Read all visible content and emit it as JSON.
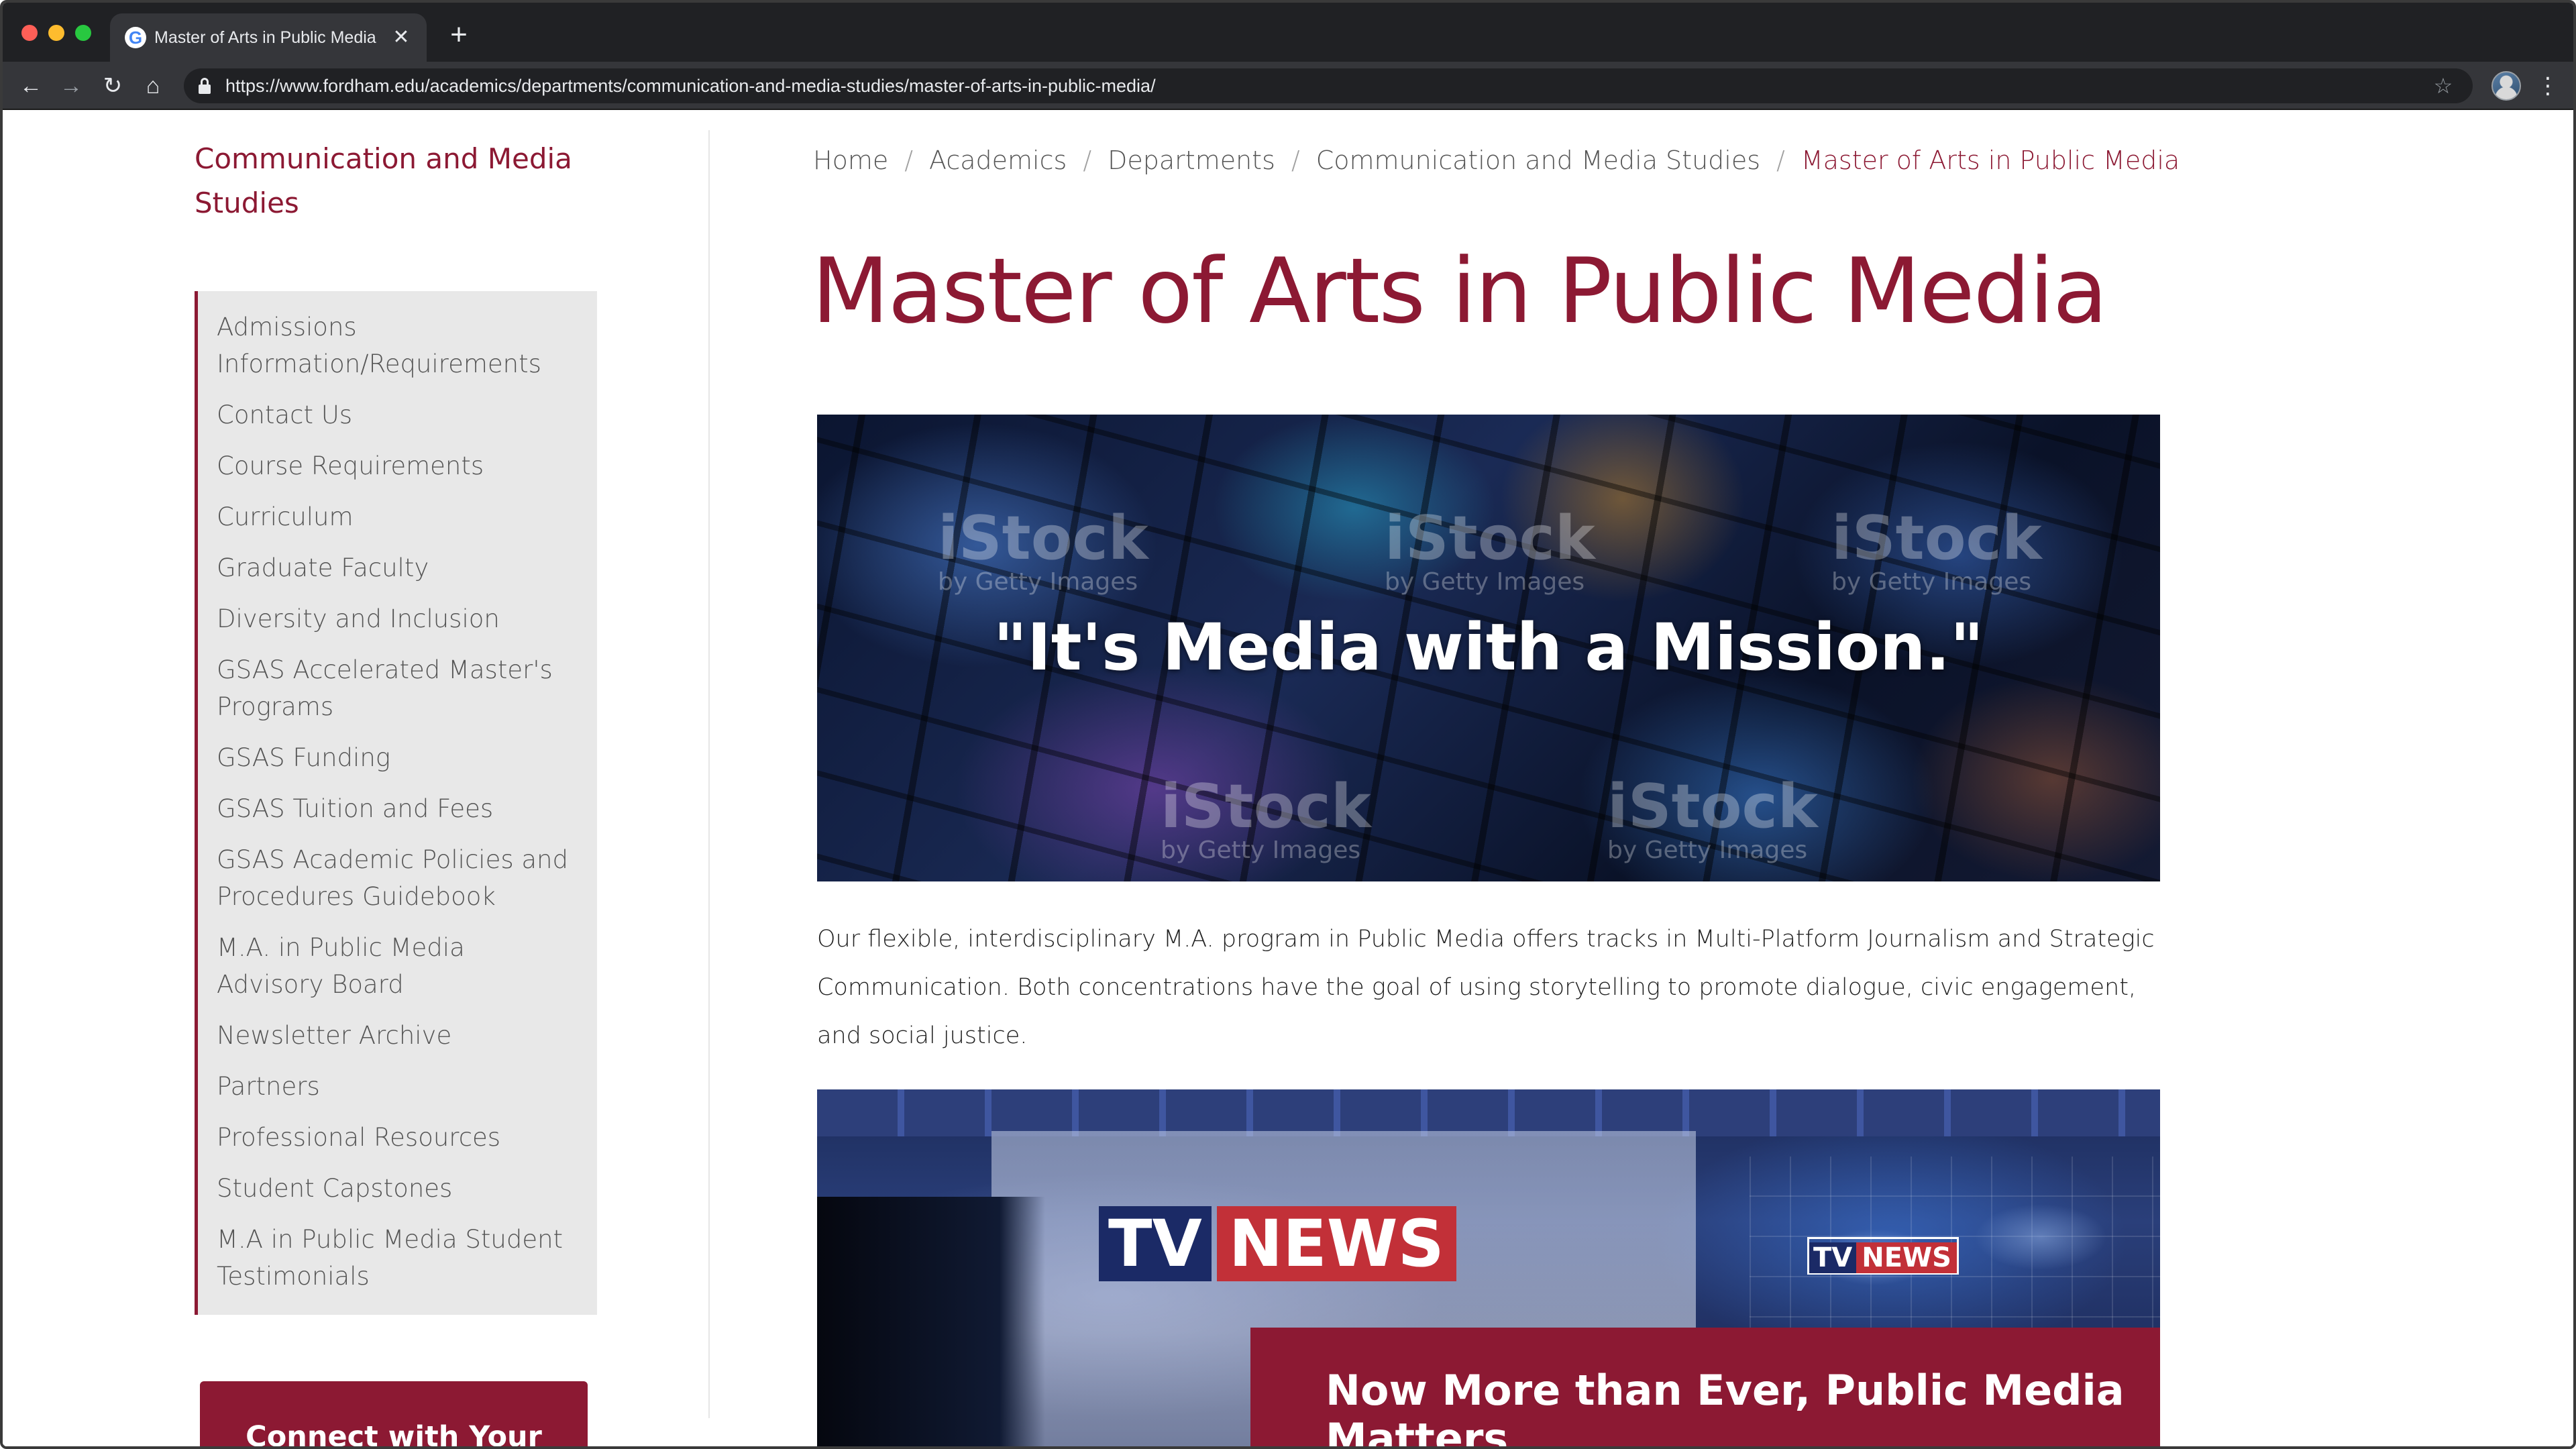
{
  "browser": {
    "tab_title": "Master of Arts in Public Media",
    "tab_favicon": "G",
    "url": "https://www.fordham.edu/academics/departments/communication-and-media-studies/master-of-arts-in-public-media/",
    "icons": {
      "back": "arrow-left-icon",
      "forward": "arrow-right-icon",
      "reload": "reload-icon",
      "home": "home-icon",
      "lock": "lock-icon",
      "bookmark": "star-icon",
      "profile": "profile-avatar-icon",
      "menu": "kebab-menu-icon",
      "close_tab": "close-icon",
      "new_tab": "plus-icon"
    }
  },
  "sidebar": {
    "heading": "Communication and Media Studies",
    "items": [
      {
        "label": "Admissions Information/Requirements"
      },
      {
        "label": "Contact Us"
      },
      {
        "label": "Course Requirements"
      },
      {
        "label": "Curriculum"
      },
      {
        "label": "Graduate Faculty"
      },
      {
        "label": "Diversity and Inclusion"
      },
      {
        "label": "GSAS Accelerated Master's Programs"
      },
      {
        "label": "GSAS Funding"
      },
      {
        "label": "GSAS Tuition and Fees"
      },
      {
        "label": "GSAS Academic Policies and Procedures Guidebook"
      },
      {
        "label": "M.A. in Public Media Advisory Board"
      },
      {
        "label": "Newsletter Archive"
      },
      {
        "label": "Partners"
      },
      {
        "label": "Professional Resources"
      },
      {
        "label": "Student Capstones"
      },
      {
        "label": "M.A in Public Media Student Testimonials"
      }
    ],
    "connect_button": "Connect with Your Program of Interest"
  },
  "breadcrumb": {
    "items": [
      "Home",
      "Academics",
      "Departments",
      "Communication and Media Studies"
    ],
    "current": "Master of Arts in Public Media",
    "separator": "/"
  },
  "main": {
    "title": "Master of Arts in Public Media",
    "hero_quote": "\"It's Media with a Mission.\"",
    "watermark_main": "iStock",
    "watermark_sub": "by Getty Images",
    "intro": "Our flexible, interdisciplinary M.A. program in Public Media offers tracks in Multi-Platform Journalism and Strategic Communication. Both concentrations have the goal of using storytelling to promote dialogue, civic engagement, and social justice.",
    "studio_sign_tv": "TV",
    "studio_sign_news": "NEWS",
    "mission_heading": "Now More than Ever, Public Media Matters"
  },
  "colors": {
    "brand": "#8c1933",
    "sidebar_bg": "#e8e8e8",
    "chrome_dark": "#202124",
    "chrome_toolbar": "#35363a",
    "text_gray": "#555555"
  }
}
